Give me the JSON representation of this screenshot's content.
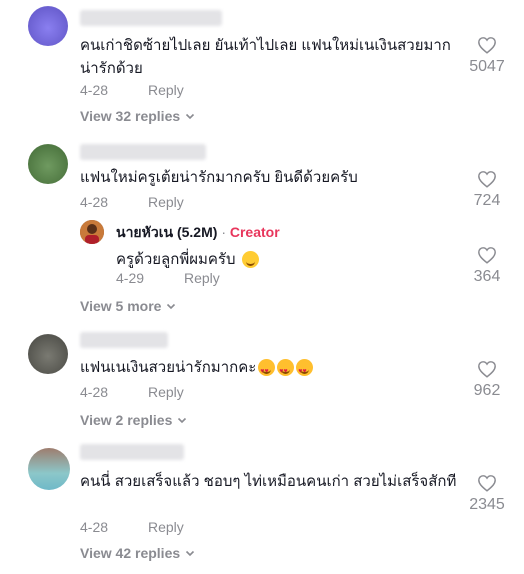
{
  "comments": [
    {
      "text": "คนเก่าชิดซ้ายไปเลย ยันเท้าไปเลย แฟนใหม่เนเงินสวยมาก น่ารักด้วย",
      "date": "4-28",
      "reply_label": "Reply",
      "likes": "5047",
      "view_replies": "View 32 replies",
      "avatar_color": "#7c6fd6"
    },
    {
      "text": "แฟนใหม่ครูเต้ยน่ารักมากครับ ยินดีด้วยครับ",
      "date": "4-28",
      "reply_label": "Reply",
      "likes": "724",
      "avatar_color": "#5f8c52",
      "reply": {
        "author": "นายหัวเน (5.2M)",
        "separator": "·",
        "badge": "Creator",
        "text": "ครูด้วยลูกพี่ผมครับ",
        "emoji": "smiling-face-emoji",
        "date": "4-29",
        "reply_label": "Reply",
        "likes": "364"
      },
      "view_more": "View 5 more"
    },
    {
      "text": "แฟนเนเงินสวยน่ารักมากคะ",
      "emojis": [
        "smiling-face-with-hearts-emoji",
        "smiling-face-with-hearts-emoji",
        "smiling-face-with-hearts-emoji"
      ],
      "date": "4-28",
      "reply_label": "Reply",
      "likes": "962",
      "view_replies": "View 2 replies",
      "avatar_color": "#6d6d66"
    },
    {
      "text": "คนนี่ สวยเสร็จแล้ว ชอบๆ ไท่เหมือนคนเก่า สวยไม่เสร็จสักที",
      "date": "4-28",
      "reply_label": "Reply",
      "likes": "2345",
      "view_replies": "View 42 replies",
      "avatar_color": "#8fb3a6"
    }
  ],
  "icons": {
    "like": "heart-outline-icon",
    "expand": "chevron-down-icon"
  }
}
